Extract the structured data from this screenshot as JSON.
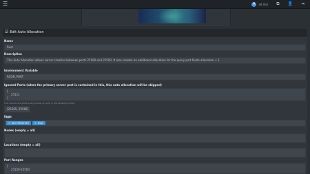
{
  "topbar": {
    "menu_icon": "hamburger-menu-icon",
    "avatar_letter": "A",
    "username": "ad min",
    "icons": [
      "panels-icon",
      "user-icon",
      "logout-icon"
    ]
  },
  "banner": {
    "image": "server-banner-image"
  },
  "card": {
    "title": "Edit Auto Allocation",
    "title_icon": "edit-checkbox-icon"
  },
  "form": {
    "name": {
      "label": "Name",
      "value": "Rust"
    },
    "description": {
      "label": "Description",
      "value": "This Auto Allocation allows server creation between ports 25100 and 25500. It also creates an additional allocation for the query port Rusts allocation + 1"
    },
    "env_var": {
      "label": "Environment Variable",
      "value": "RCON_PORT"
    },
    "ignored_ports": {
      "label": "Ignored Ports (when the primary server port is contained in this, this auto allocation will be skipped)",
      "lines": [
        "[",
        "  25111",
        "]"
      ],
      "help": "This should be a JSON array(number of ports in the following format",
      "example": "[25565, 25566]"
    },
    "eggs": {
      "label": "Eggs",
      "chips": [
        "Java Minecraft",
        "Rust"
      ],
      "chip_remove": "×"
    },
    "nodes": {
      "label": "Nodes (empty = all)",
      "value": ""
    },
    "locations": {
      "label": "Locations (empty = all)",
      "value": ""
    },
    "port_ranges": {
      "label": "Port Ranges",
      "lines": [
        "[",
        "  25100-25500"
      ]
    }
  }
}
